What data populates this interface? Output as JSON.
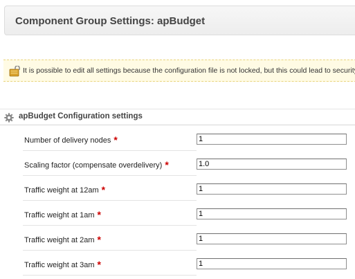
{
  "header": {
    "title": "Component Group Settings: apBudget"
  },
  "warning": {
    "icon": "lock-warning-icon",
    "text": "It is possible to edit all settings because the configuration file is not locked, but this could lead to security issues."
  },
  "section": {
    "icon": "gear-icon",
    "title": "apBudget Configuration settings"
  },
  "settings": [
    {
      "label": "Number of delivery nodes",
      "required": "*",
      "value": "1"
    },
    {
      "label": "Scaling factor (compensate overdelivery)",
      "required": "*",
      "value": "1.0"
    },
    {
      "label": "Traffic weight at 12am",
      "required": "*",
      "value": "1"
    },
    {
      "label": "Traffic weight at 1am",
      "required": "*",
      "value": "1"
    },
    {
      "label": "Traffic weight at 2am",
      "required": "*",
      "value": "1"
    },
    {
      "label": "Traffic weight at 3am",
      "required": "*",
      "value": "1"
    }
  ],
  "colors": {
    "required": "#cc0000",
    "warning_background": "#fffbe4",
    "warning_border": "#e8d37a"
  }
}
